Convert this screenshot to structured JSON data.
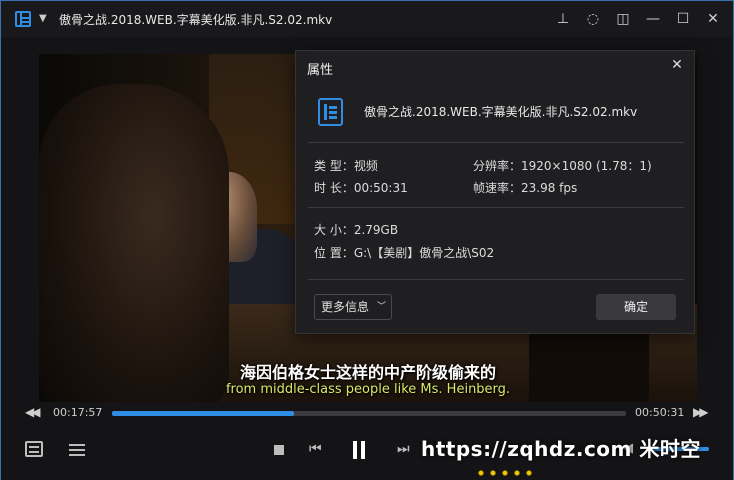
{
  "window": {
    "title": "傲骨之战.2018.WEB.字幕美化版.非凡.S2.02.mkv",
    "accent": "#2f8de4"
  },
  "titlebar_buttons": [
    "pin-icon",
    "bulb-icon",
    "pip-icon",
    "minimize-icon",
    "maximize-icon",
    "close-icon"
  ],
  "subtitle": {
    "zh": "海因伯格女士这样的中产阶级偷来的",
    "en": "from middle-class people like Ms. Heinberg."
  },
  "playback": {
    "current_time": "00:17:57",
    "total_time": "00:50:31",
    "progress": 0.355
  },
  "watermark": "https://zqhdz.com 米时空",
  "dialog": {
    "title": "属性",
    "file_name": "傲骨之战.2018.WEB.字幕美化版.非凡.S2.02.mkv",
    "type": "类 型：视频",
    "resolution": "分辨率：1920×1080 (1.78：1)",
    "duration": "时 长：00:50:31",
    "framerate": "帧速率：23.98 fps",
    "size": "大 小：2.79GB",
    "location": "位 置：G:\\【美剧】傲骨之战\\S02",
    "more_info": "更多信息",
    "ok": "确定"
  }
}
